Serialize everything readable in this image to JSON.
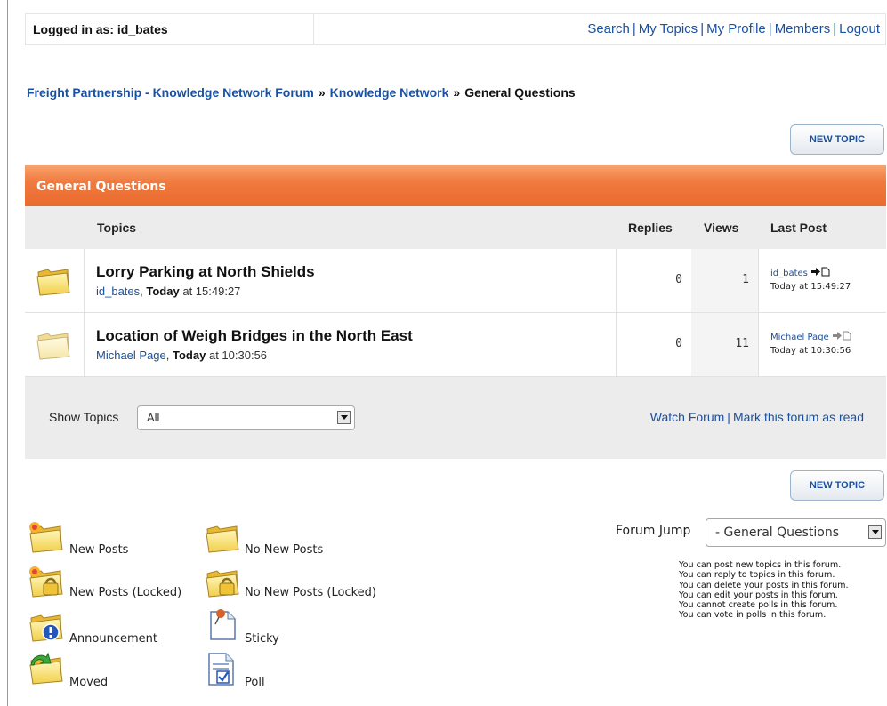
{
  "topbar": {
    "logged_in": "Logged in as: id_bates",
    "links": [
      "Search",
      "My Topics",
      "My Profile",
      "Members",
      "Logout"
    ]
  },
  "breadcrumb": {
    "items": [
      "Freight Partnership - Knowledge Network Forum",
      "Knowledge Network"
    ],
    "current": "General Questions"
  },
  "buttons": {
    "new_topic": "NEW TOPIC"
  },
  "forum": {
    "title": "General Questions",
    "columns": {
      "topics": "Topics",
      "replies": "Replies",
      "views": "Views",
      "last_post": "Last Post"
    },
    "topics": [
      {
        "title": "Lorry Parking at North Shields",
        "author": "id_bates",
        "day": "Today",
        "time": "at 15:49:27",
        "replies": "0",
        "views": "1",
        "last_user": "id_bates",
        "last_time": "Today at 15:49:27",
        "status": "new-posts"
      },
      {
        "title": "Location of Weigh Bridges in the North East",
        "author": "Michael Page",
        "day": "Today",
        "time": "at 10:30:56",
        "replies": "0",
        "views": "11",
        "last_user": "Michael Page",
        "last_time": "Today at 10:30:56",
        "status": "no-new-posts"
      }
    ]
  },
  "footer": {
    "show_topics_label": "Show Topics",
    "show_topics_value": "All",
    "watch_forum": "Watch Forum",
    "mark_read": "Mark this forum as read"
  },
  "legend": {
    "new_posts": "New Posts",
    "no_new_posts": "No New Posts",
    "new_posts_locked": "New Posts (Locked)",
    "no_new_posts_locked": "No New Posts (Locked)",
    "announcement": "Announcement",
    "sticky": "Sticky",
    "moved": "Moved",
    "poll": "Poll"
  },
  "forum_jump": {
    "label": "Forum Jump",
    "value": "- General Questions"
  },
  "permissions": [
    "You can post new topics in this forum.",
    "You can reply to topics in this forum.",
    "You can delete your posts in this forum.",
    "You can edit your posts in this forum.",
    "You cannot create polls in this forum.",
    "You can vote in polls in this forum."
  ],
  "colors": {
    "header_orange": "#f07a3f",
    "link_blue": "#1a50a0",
    "panel_grey": "#ececec"
  }
}
